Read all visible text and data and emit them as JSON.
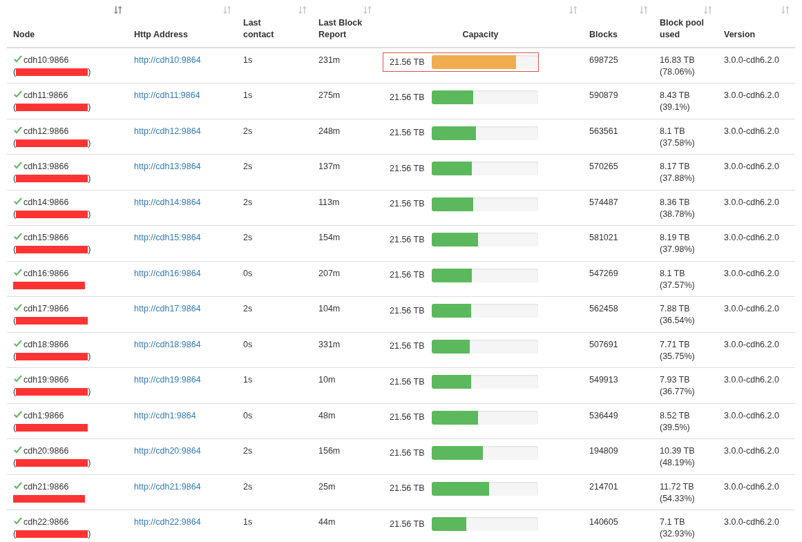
{
  "table": {
    "columns": [
      {
        "label": "Node",
        "sorted": true
      },
      {
        "label": "Http Address",
        "sorted": false
      },
      {
        "label": "Last contact",
        "sorted": false
      },
      {
        "label": "Last Block Report",
        "sorted": false
      },
      {
        "label": "Capacity",
        "sorted": false
      },
      {
        "label": "Blocks",
        "sorted": false
      },
      {
        "label": "Block pool used",
        "sorted": false
      },
      {
        "label": "Version",
        "sorted": false
      }
    ],
    "rows": [
      {
        "node": "cdh10:9866",
        "address_open": "(",
        "address_close": ")",
        "http": "http://cdh10:9864",
        "last_contact": "1s",
        "last_block_report": "231m",
        "capacity": "21.56 TB",
        "level": 0.79,
        "warning": true,
        "highlighted": true,
        "blocks": "698725",
        "pool_used": "16.83 TB",
        "pool_percent": "(78.06%)",
        "version": "3.0.0-cdh6.2.0"
      },
      {
        "node": "cdh11:9866",
        "address_open": "(",
        "address_close": ")",
        "http": "http://cdh11:9864",
        "last_contact": "1s",
        "last_block_report": "275m",
        "capacity": "21.56 TB",
        "level": 0.39,
        "warning": false,
        "highlighted": false,
        "blocks": "590879",
        "pool_used": "8.43 TB",
        "pool_percent": "(39.1%)",
        "version": "3.0.0-cdh6.2.0"
      },
      {
        "node": "cdh12:9866",
        "address_open": "(",
        "address_close": ")",
        "http": "http://cdh12:9864",
        "last_contact": "2s",
        "last_block_report": "248m",
        "capacity": "21.56 TB",
        "level": 0.42,
        "warning": false,
        "highlighted": false,
        "blocks": "563561",
        "pool_used": "8.1 TB",
        "pool_percent": "(37.58%)",
        "version": "3.0.0-cdh6.2.0"
      },
      {
        "node": "cdh13:9866",
        "address_open": "(",
        "address_close": ")",
        "http": "http://cdh13:9864",
        "last_contact": "2s",
        "last_block_report": "137m",
        "capacity": "21.56 TB",
        "level": 0.38,
        "warning": false,
        "highlighted": false,
        "blocks": "570265",
        "pool_used": "8.17 TB",
        "pool_percent": "(37.88%)",
        "version": "3.0.0-cdh6.2.0"
      },
      {
        "node": "cdh14:9866",
        "address_open": "(",
        "address_close": ")",
        "http": "http://cdh14:9864",
        "last_contact": "2s",
        "last_block_report": "113m",
        "capacity": "21.56 TB",
        "level": 0.39,
        "warning": false,
        "highlighted": false,
        "blocks": "574487",
        "pool_used": "8.36 TB",
        "pool_percent": "(38.78%)",
        "version": "3.0.0-cdh6.2.0"
      },
      {
        "node": "cdh15:9866",
        "address_open": "(",
        "address_close": ")",
        "http": "http://cdh15:9864",
        "last_contact": "2s",
        "last_block_report": "154m",
        "capacity": "21.56 TB",
        "level": 0.435,
        "warning": false,
        "highlighted": false,
        "blocks": "581021",
        "pool_used": "8.19 TB",
        "pool_percent": "(37.98%)",
        "version": "3.0.0-cdh6.2.0"
      },
      {
        "node": "cdh16:9866",
        "http": "http://cdh16:9864",
        "last_contact": "0s",
        "last_block_report": "207m",
        "capacity": "21.56 TB",
        "level": 0.38,
        "warning": false,
        "highlighted": false,
        "blocks": "547269",
        "pool_used": "8.1 TB",
        "pool_percent": "(37.57%)",
        "version": "3.0.0-cdh6.2.0"
      },
      {
        "node": "cdh17:9866",
        "address_open": "(",
        "http": "http://cdh17:9864",
        "last_contact": "2s",
        "last_block_report": "104m",
        "capacity": "21.56 TB",
        "level": 0.37,
        "warning": false,
        "highlighted": false,
        "blocks": "562458",
        "pool_used": "7.88 TB",
        "pool_percent": "(36.54%)",
        "version": "3.0.0-cdh6.2.0"
      },
      {
        "node": "cdh18:9866",
        "address_open": "(",
        "address_close": ")",
        "http": "http://cdh18:9864",
        "last_contact": "0s",
        "last_block_report": "331m",
        "capacity": "21.56 TB",
        "level": 0.36,
        "warning": false,
        "highlighted": false,
        "blocks": "507691",
        "pool_used": "7.71 TB",
        "pool_percent": "(35.75%)",
        "version": "3.0.0-cdh6.2.0"
      },
      {
        "node": "cdh19:9866",
        "address_open": "(",
        "address_close": ")",
        "http": "http://cdh19:9864",
        "last_contact": "1s",
        "last_block_report": "10m",
        "capacity": "21.56 TB",
        "level": 0.37,
        "warning": false,
        "highlighted": false,
        "blocks": "549913",
        "pool_used": "7.93 TB",
        "pool_percent": "(36.77%)",
        "version": "3.0.0-cdh6.2.0"
      },
      {
        "node": "cdh1:9866",
        "address_open": "(",
        "http": "http://cdh1:9864",
        "last_contact": "0s",
        "last_block_report": "48m",
        "capacity": "21.56 TB",
        "level": 0.44,
        "warning": false,
        "highlighted": false,
        "blocks": "536449",
        "pool_used": "8.52 TB",
        "pool_percent": "(39.5%)",
        "version": "3.0.0-cdh6.2.0"
      },
      {
        "node": "cdh20:9866",
        "address_open": "(",
        "address_close": ")",
        "http": "http://cdh20:9864",
        "last_contact": "2s",
        "last_block_report": "156m",
        "capacity": "21.56 TB",
        "level": 0.48,
        "warning": false,
        "highlighted": false,
        "blocks": "194809",
        "pool_used": "10.39 TB",
        "pool_percent": "(48.19%)",
        "version": "3.0.0-cdh6.2.0"
      },
      {
        "node": "cdh21:9866",
        "http": "http://cdh21:9864",
        "last_contact": "2s",
        "last_block_report": "25m",
        "capacity": "21.56 TB",
        "level": 0.54,
        "warning": false,
        "highlighted": false,
        "blocks": "214701",
        "pool_used": "11.72 TB",
        "pool_percent": "(54.33%)",
        "version": "3.0.0-cdh6.2.0"
      },
      {
        "node": "cdh22:9866",
        "address_open": "(",
        "address_close": ")",
        "http": "http://cdh22:9864",
        "last_contact": "1s",
        "last_block_report": "44m",
        "capacity": "21.56 TB",
        "level": 0.33,
        "warning": false,
        "highlighted": false,
        "blocks": "140605",
        "pool_used": "7.1 TB",
        "pool_percent": "(32.93%)",
        "version": "3.0.0-cdh6.2.0"
      }
    ]
  }
}
